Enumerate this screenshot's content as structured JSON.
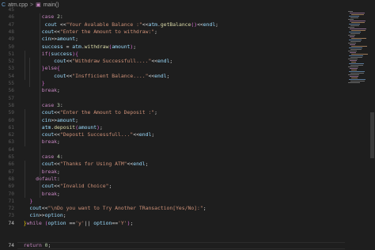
{
  "tab": {
    "file_name": "atm.cpp",
    "separator": ">",
    "symbol": "main()"
  },
  "editor": {
    "current_line_number": "74",
    "line_numbers": [
      "45",
      "46",
      "47",
      "48",
      "49",
      "50",
      "51",
      "52",
      "53",
      "54",
      "55",
      "56",
      "57",
      "58",
      "59",
      "60",
      "61",
      "62",
      "63",
      "64",
      "65",
      "66",
      "67",
      "68",
      "69",
      "70",
      "71",
      "72",
      "73",
      "74",
      "75"
    ],
    "code_lines": [
      [],
      [
        [
          "        ",
          "op"
        ],
        [
          "case ",
          "kw"
        ],
        [
          "2",
          "num"
        ],
        [
          ":",
          "op"
        ]
      ],
      [
        [
          "         ",
          "op"
        ],
        [
          "cout ",
          "id"
        ],
        [
          "<<",
          "op"
        ],
        [
          "\"Your Avalable Balance :\"",
          "str"
        ],
        [
          "<<",
          "op"
        ],
        [
          "atm",
          "id"
        ],
        [
          ".",
          "op"
        ],
        [
          "getBalance",
          "fn"
        ],
        [
          "()",
          "brace-p"
        ],
        [
          "<<",
          "op"
        ],
        [
          "endl",
          "id"
        ],
        [
          ";",
          "op"
        ]
      ],
      [
        [
          "        ",
          "op"
        ],
        [
          "cout",
          "id"
        ],
        [
          "<<",
          "op"
        ],
        [
          "\"Enter the Amount to withdraw:\"",
          "str"
        ],
        [
          ";",
          "op"
        ]
      ],
      [
        [
          "        ",
          "op"
        ],
        [
          "cin",
          "id"
        ],
        [
          ">>",
          "op"
        ],
        [
          "amount",
          "id"
        ],
        [
          ";",
          "op"
        ]
      ],
      [
        [
          "        ",
          "op"
        ],
        [
          "success ",
          "id"
        ],
        [
          "= ",
          "op"
        ],
        [
          "atm",
          "id"
        ],
        [
          ".",
          "op"
        ],
        [
          "withdraw",
          "fn"
        ],
        [
          "(",
          "brace-p"
        ],
        [
          "amount",
          "id"
        ],
        [
          ")",
          "brace-p"
        ],
        [
          ";",
          "op"
        ]
      ],
      [
        [
          "        ",
          "op"
        ],
        [
          "if",
          "kw"
        ],
        [
          "(",
          "brace-p"
        ],
        [
          "success",
          "id"
        ],
        [
          ")",
          "brace-p"
        ],
        [
          "{",
          "brace-p"
        ]
      ],
      [
        [
          "            ",
          "op"
        ],
        [
          "cout",
          "id"
        ],
        [
          "<<",
          "op"
        ],
        [
          "\"Withdraw Successfull....\"",
          "str"
        ],
        [
          "<<",
          "op"
        ],
        [
          "endl",
          "id"
        ],
        [
          ";",
          "op"
        ]
      ],
      [
        [
          "        ",
          "op"
        ],
        [
          "}",
          "brace-p"
        ],
        [
          "else",
          "kw"
        ],
        [
          "{",
          "brace-p"
        ]
      ],
      [
        [
          "            ",
          "op"
        ],
        [
          "cout",
          "id"
        ],
        [
          "<<",
          "op"
        ],
        [
          "\"Insfficient Balance....\"",
          "str"
        ],
        [
          "<<",
          "op"
        ],
        [
          "endl",
          "id"
        ],
        [
          ";",
          "op"
        ]
      ],
      [
        [
          "        ",
          "op"
        ],
        [
          "}",
          "brace-p"
        ]
      ],
      [
        [
          "        ",
          "op"
        ],
        [
          "break",
          "kw"
        ],
        [
          ";",
          "op"
        ]
      ],
      [],
      [
        [
          "        ",
          "op"
        ],
        [
          "case ",
          "kw"
        ],
        [
          "3",
          "num"
        ],
        [
          ":",
          "op"
        ]
      ],
      [
        [
          "        ",
          "op"
        ],
        [
          "cout",
          "id"
        ],
        [
          "<<",
          "op"
        ],
        [
          "\"Enter the Amount to Deposit :\"",
          "str"
        ],
        [
          ";",
          "op"
        ]
      ],
      [
        [
          "        ",
          "op"
        ],
        [
          "cin",
          "id"
        ],
        [
          ">>",
          "op"
        ],
        [
          "amount",
          "id"
        ],
        [
          ";",
          "op"
        ]
      ],
      [
        [
          "        ",
          "op"
        ],
        [
          "atm",
          "id"
        ],
        [
          ".",
          "op"
        ],
        [
          "deposit",
          "fn"
        ],
        [
          "(",
          "brace-p"
        ],
        [
          "amount",
          "id"
        ],
        [
          ")",
          "brace-p"
        ],
        [
          ";",
          "op"
        ]
      ],
      [
        [
          "        ",
          "op"
        ],
        [
          "cout",
          "id"
        ],
        [
          "<<",
          "op"
        ],
        [
          "\"Deposti Successfull...\"",
          "str"
        ],
        [
          "<<",
          "op"
        ],
        [
          "endl",
          "id"
        ],
        [
          ";",
          "op"
        ]
      ],
      [
        [
          "        ",
          "op"
        ],
        [
          "break",
          "kw"
        ],
        [
          ";",
          "op"
        ]
      ],
      [],
      [
        [
          "        ",
          "op"
        ],
        [
          "case ",
          "kw"
        ],
        [
          "4",
          "num"
        ],
        [
          ":",
          "op"
        ]
      ],
      [
        [
          "        ",
          "op"
        ],
        [
          "cout",
          "id"
        ],
        [
          "<<",
          "op"
        ],
        [
          "\"Thanks for Using ATM\"",
          "str"
        ],
        [
          "<<",
          "op"
        ],
        [
          "endl",
          "id"
        ],
        [
          ";",
          "op"
        ]
      ],
      [
        [
          "        ",
          "op"
        ],
        [
          "break",
          "kw"
        ],
        [
          ";",
          "op"
        ]
      ],
      [
        [
          "      ",
          "op"
        ],
        [
          "default",
          "kw"
        ],
        [
          ":",
          "op"
        ]
      ],
      [
        [
          "        ",
          "op"
        ],
        [
          "cout",
          "id"
        ],
        [
          "<<",
          "op"
        ],
        [
          "\"Invalid Choice\"",
          "str"
        ],
        [
          ";",
          "op"
        ]
      ],
      [
        [
          "        ",
          "op"
        ],
        [
          "break",
          "kw"
        ],
        [
          ";",
          "op"
        ]
      ],
      [
        [
          "    ",
          "op"
        ],
        [
          "}",
          "brace-p"
        ]
      ],
      [
        [
          "    ",
          "op"
        ],
        [
          "cout",
          "id"
        ],
        [
          "<<",
          "op"
        ],
        [
          "\"\\nDo you want to Try Another TRansaction[Yes/No]:\"",
          "str"
        ],
        [
          ";",
          "op"
        ]
      ],
      [
        [
          "    ",
          "op"
        ],
        [
          "cin",
          "id"
        ],
        [
          ">>",
          "op"
        ],
        [
          "option",
          "id"
        ],
        [
          ";",
          "op"
        ]
      ],
      [
        [
          "  ",
          "op"
        ],
        [
          "}",
          "brace-y"
        ],
        [
          "while ",
          "kw"
        ],
        [
          "(",
          "brace-p"
        ],
        [
          "option ",
          "id"
        ],
        [
          "==",
          "op"
        ],
        [
          "'y'",
          "str"
        ],
        [
          "|| ",
          "op"
        ],
        [
          "option",
          "id"
        ],
        [
          "==",
          "op"
        ],
        [
          "'Y'",
          "str"
        ],
        [
          ")",
          "brace-p"
        ],
        [
          ";",
          "op"
        ]
      ],
      [],
      [],
      [
        [
          "  ",
          "op"
        ],
        [
          "return ",
          "kw"
        ],
        [
          "0",
          "num"
        ],
        [
          ";",
          "op"
        ]
      ],
      [
        [
          "}",
          "brace-y"
        ]
      ]
    ]
  }
}
